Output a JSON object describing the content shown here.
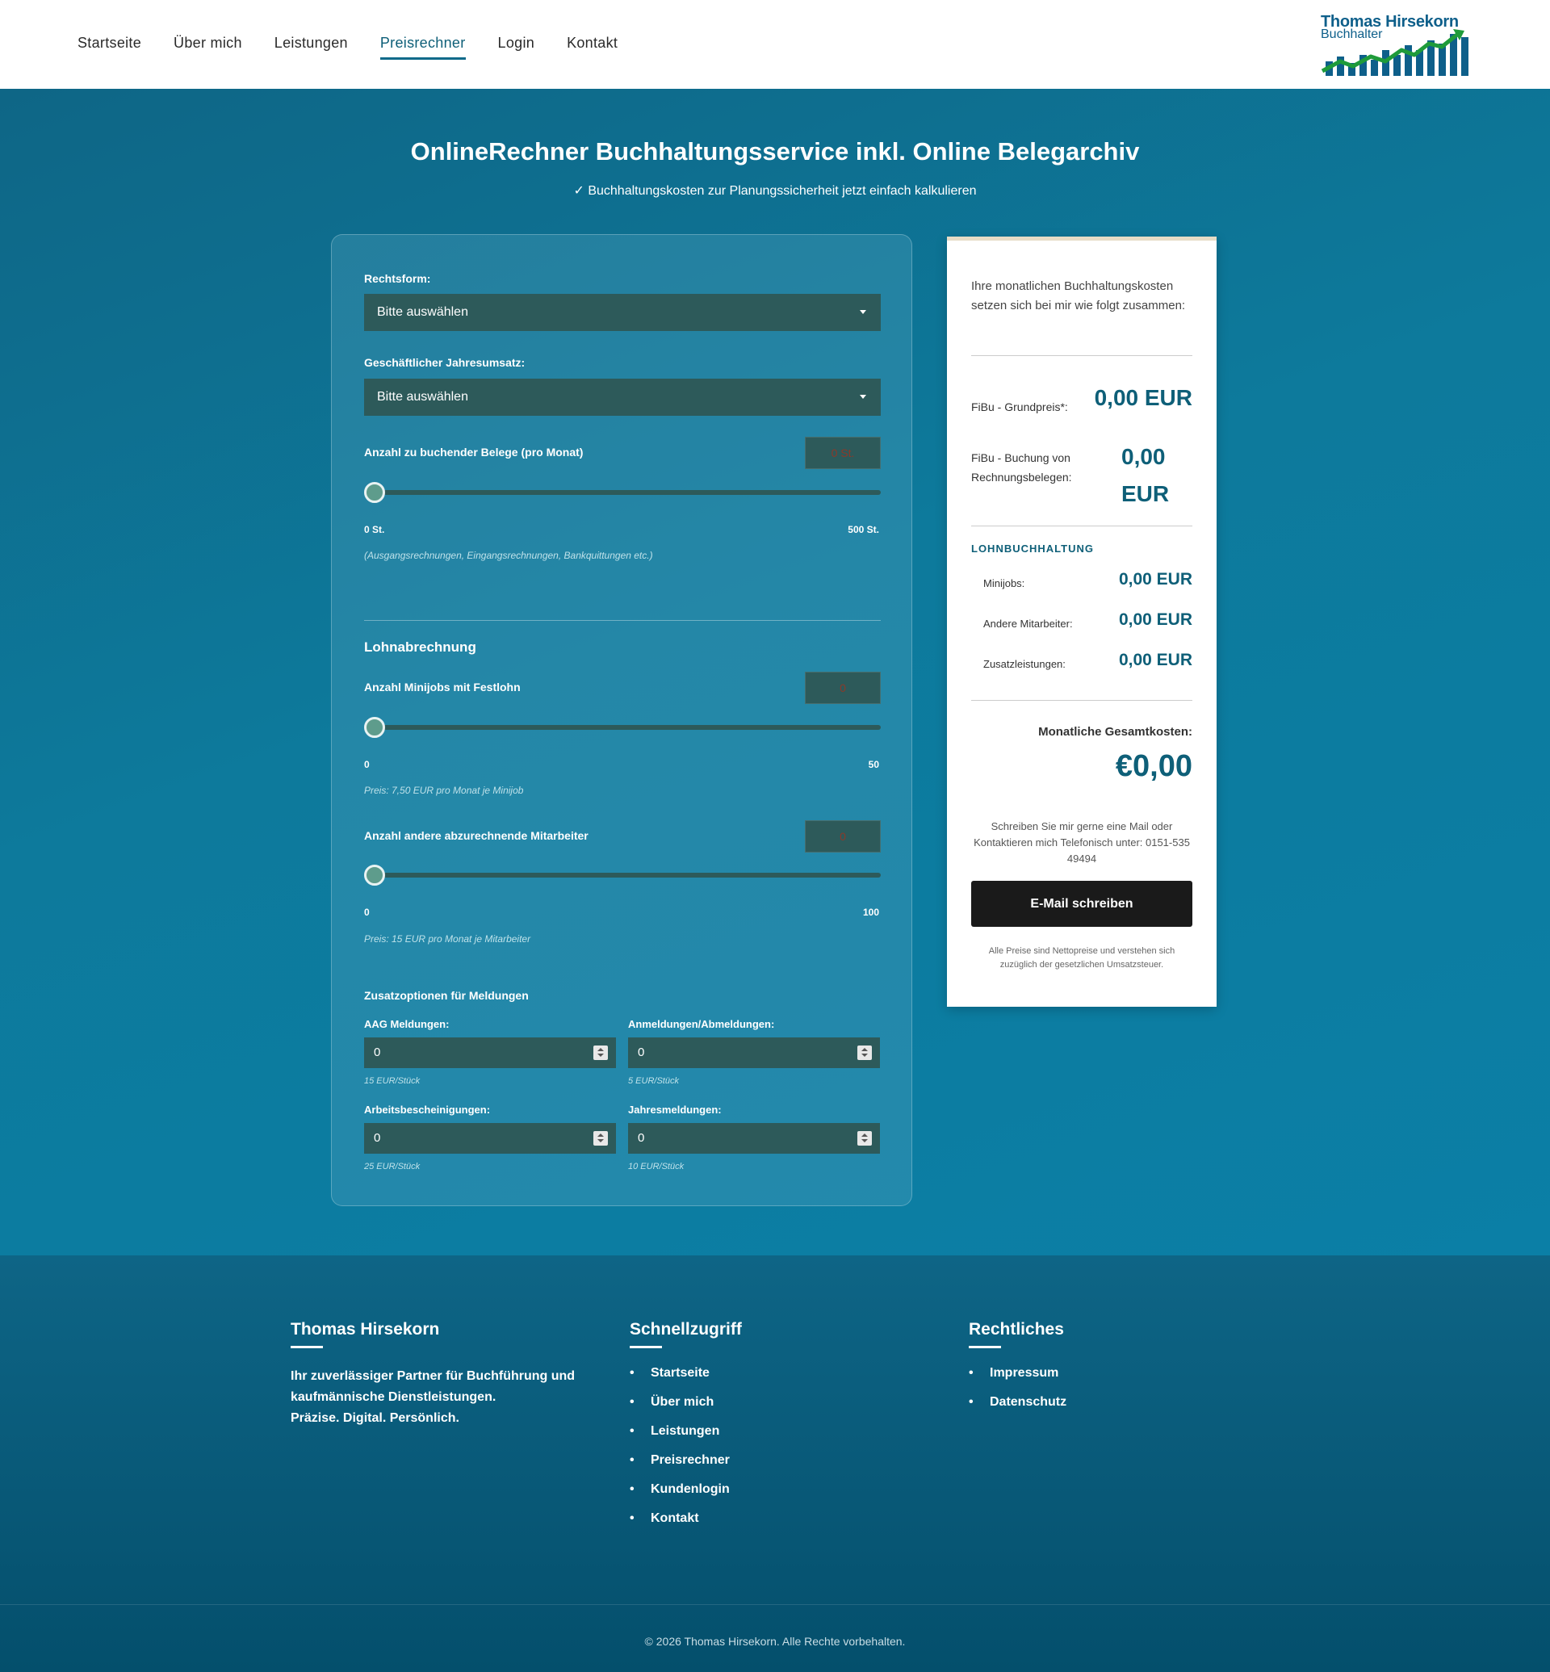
{
  "nav": {
    "items": [
      {
        "label": "Startseite",
        "active": false
      },
      {
        "label": "Über mich",
        "active": false
      },
      {
        "label": "Leistungen",
        "active": false
      },
      {
        "label": "Preisrechner",
        "active": true
      },
      {
        "label": "Login",
        "active": false
      },
      {
        "label": "Kontakt",
        "active": false
      }
    ],
    "logo_name": "Thomas Hirsekorn",
    "logo_sub": "Buchhalter"
  },
  "hero": {
    "title": "OnlineRechner Buchhaltungsservice inkl. Online Belegarchiv",
    "subtitle": "✓ Buchhaltungskosten zur Planungssicherheit jetzt einfach kalkulieren"
  },
  "calculator": {
    "rechtsform_label": "Rechtsform:",
    "rechtsform_value": "Bitte auswählen",
    "umsatz_label": "Geschäftlicher Jahresumsatz:",
    "umsatz_value": "Bitte auswählen",
    "belege_label": "Anzahl zu buchender Belege (pro Monat)",
    "belege_value": "0 St.",
    "belege_min": "0 St.",
    "belege_max": "500 St.",
    "belege_hint": "(Ausgangsrechnungen, Eingangsrechnungen, Bankquittungen etc.)",
    "lohn_heading": "Lohnabrechnung",
    "minijobs_label": "Anzahl Minijobs mit Festlohn",
    "minijobs_value": "0",
    "minijobs_min": "0",
    "minijobs_max": "50",
    "minijobs_hint": "Preis: 7,50 EUR pro Monat je Minijob",
    "mitarbeiter_label": "Anzahl andere abzurechnende Mitarbeiter",
    "mitarbeiter_value": "0",
    "mitarbeiter_min": "0",
    "mitarbeiter_max": "100",
    "mitarbeiter_hint": "Preis: 15 EUR pro Monat je Mitarbeiter",
    "zusatz_heading": "Zusatzoptionen für Meldungen",
    "options": [
      {
        "label": "AAG Meldungen:",
        "value": "0",
        "hint": "15 EUR/Stück"
      },
      {
        "label": "Anmeldungen/Abmeldungen:",
        "value": "0",
        "hint": "5 EUR/Stück"
      },
      {
        "label": "Arbeitsbescheinigungen:",
        "value": "0",
        "hint": "25 EUR/Stück"
      },
      {
        "label": "Jahresmeldungen:",
        "value": "0",
        "hint": "10 EUR/Stück"
      }
    ]
  },
  "summary": {
    "intro": "Ihre monatlichen Buchhaltungskosten setzen sich bei mir wie folgt zusammen:",
    "grundpreis_label": "FiBu - Grundpreis*:",
    "grundpreis_value": "0,00 EUR",
    "buchung_label": "FiBu - Buchung von Rechnungsbelegen:",
    "buchung_value": "0,00 EUR",
    "lohn_heading": "LOHNBUCHHALTUNG",
    "minijobs_label": "Minijobs:",
    "minijobs_value": "0,00 EUR",
    "mitarbeiter_label": "Andere Mitarbeiter:",
    "mitarbeiter_value": "0,00 EUR",
    "zusatz_label": "Zusatzleistungen:",
    "zusatz_value": "0,00 EUR",
    "total_label": "Monatliche Gesamtkosten:",
    "total_value": "€0,00",
    "contact_text": "Schreiben Sie mir gerne eine Mail oder Kontaktieren mich Telefonisch unter: 0151-535 49494",
    "email_button": "E-Mail schreiben",
    "note": "Alle Preise sind Nettopreise und verstehen sich zuzüglich der gesetzlichen Umsatzsteuer."
  },
  "footer": {
    "col1_title": "Thomas Hirsekorn",
    "col1_text": "Ihr zuverlässiger Partner für Buchführung und kaufmännische Dienstleistungen.",
    "col1_text2": "Präzise. Digital. Persönlich.",
    "col2_title": "Schnellzugriff",
    "col2_links": [
      "Startseite",
      "Über mich",
      "Leistungen",
      "Preisrechner",
      "Kundenlogin",
      "Kontakt"
    ],
    "col3_title": "Rechtliches",
    "col3_links": [
      "Impressum",
      "Datenschutz"
    ],
    "copyright": "© 2026 Thomas Hirsekorn. Alle Rechte vorbehalten."
  },
  "colors": {
    "brand": "#0e5f78",
    "hero_bg": "#0b7fa6",
    "select_bg": "#2d5a5a",
    "button_dark": "#1a1a1a"
  }
}
